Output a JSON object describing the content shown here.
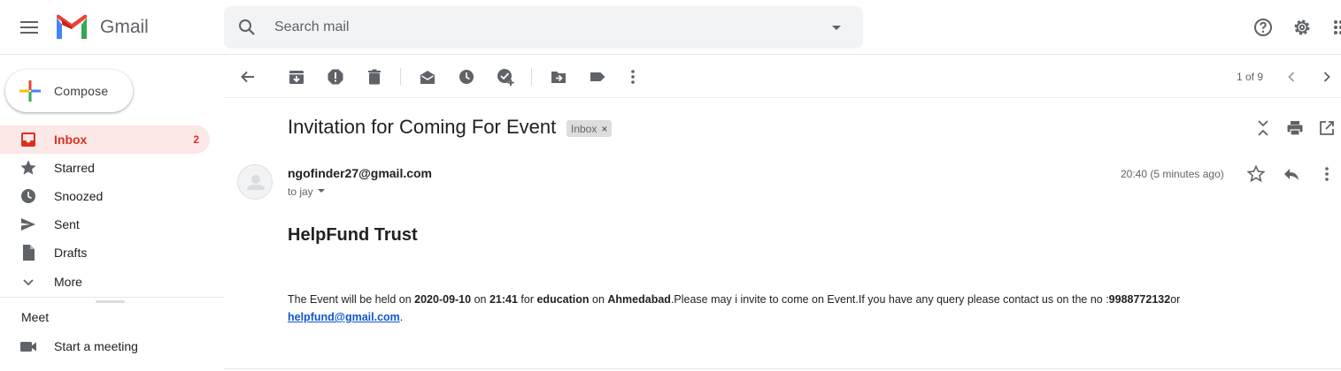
{
  "app": {
    "name": "Gmail"
  },
  "header": {
    "search_placeholder": "Search mail",
    "icons": [
      "menu-icon",
      "gmail-logo",
      "search-icon",
      "search-options-icon",
      "help-icon",
      "settings-icon",
      "apps-icon"
    ]
  },
  "sidebar": {
    "compose_label": "Compose",
    "items": [
      {
        "label": "Inbox",
        "count": "2",
        "icon": "inbox-icon",
        "active": true
      },
      {
        "label": "Starred",
        "icon": "star-icon"
      },
      {
        "label": "Snoozed",
        "icon": "clock-icon"
      },
      {
        "label": "Sent",
        "icon": "send-icon"
      },
      {
        "label": "Drafts",
        "icon": "draft-icon"
      },
      {
        "label": "More",
        "icon": "chevron-down-icon"
      }
    ],
    "meet": {
      "title": "Meet",
      "items": [
        {
          "label": "Start a meeting",
          "icon": "video-icon"
        }
      ]
    }
  },
  "toolbar": {
    "pager": "1 of 9",
    "buttons": [
      "back-icon",
      "archive-icon",
      "report-spam-icon",
      "delete-icon",
      "mark-unread-icon",
      "snooze-icon",
      "add-to-tasks-icon",
      "move-to-icon",
      "labels-icon",
      "more-icon",
      "newer-icon",
      "older-icon"
    ]
  },
  "email": {
    "subject": "Invitation for Coming For Event",
    "label_chip": "Inbox",
    "label_chip_close": "×",
    "sender": "ngofinder27@gmail.com",
    "to": "to jay",
    "time": "20:40 (5 minutes ago)",
    "org_title": "HelpFund Trust",
    "body": {
      "p1": "The Event will be held on ",
      "date": "2020-09-10",
      "p2": " on ",
      "time": "21:41",
      "p3": " for ",
      "category": "education",
      "p4": " on ",
      "city": "Ahmedabad",
      "p5": ".Please may i invite to come on Event.If you have any query please contact us on the no :",
      "phone": "9988772132",
      "p6": "or",
      "email": "helpfund@gmail.com",
      "p7": "."
    }
  },
  "colors": {
    "accent_red": "#d93025",
    "active_bg": "#fce8e6",
    "link": "#1155cc",
    "icon_gray": "#5f6368"
  }
}
